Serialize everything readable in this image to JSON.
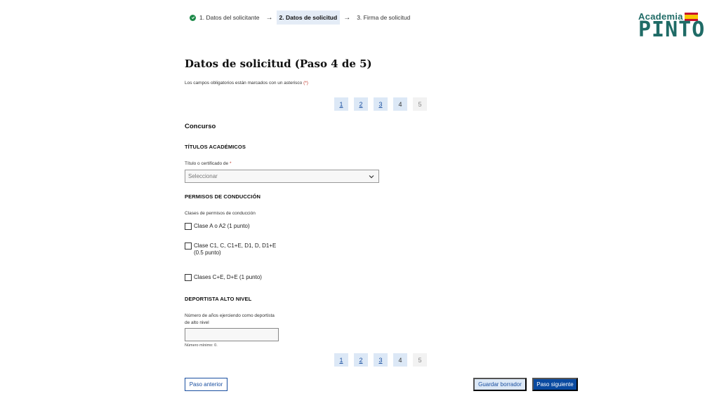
{
  "stepper": {
    "steps": [
      {
        "label": "1. Datos del solicitante",
        "state": "done"
      },
      {
        "label": "2. Datos de solicitud",
        "state": "active"
      },
      {
        "label": "3. Firma de solicitud",
        "state": "pending"
      }
    ],
    "separator": "→"
  },
  "logo": {
    "top": "Academia",
    "main": "PINTO"
  },
  "page_title": "Datos de solicitud (Paso 4 de 5)",
  "required_note": "Los campos obligatorios están marcados con un asterisco",
  "required_mark": "(*)",
  "pagination": [
    "1",
    "2",
    "3",
    "4",
    "5"
  ],
  "section_title": "Concurso",
  "academic": {
    "heading": "TÍTULOS ACADÉMICOS",
    "field_label": "Título o certificado de",
    "required": "*",
    "select_value": "Seleccionar"
  },
  "driving": {
    "heading": "PERMISOS DE CONDUCCIÓN",
    "field_label": "Clases de permisos de conducción",
    "options": [
      {
        "line1": "Clase A o A2 (1 punto)",
        "line2": ""
      },
      {
        "line1": "Clase C1, C, C1+E, D1, D, D1+E",
        "line2": "(0.5 punto)"
      },
      {
        "line1": "Clases C+E, D+E (1 punto)",
        "line2": ""
      }
    ]
  },
  "athlete": {
    "heading": "DEPORTISTA ALTO NIVEL",
    "field_label_1": "Número de años ejerciendo como deportista",
    "field_label_2": "de alto nivel",
    "input_value": "",
    "hint": "Número mínimo: 0."
  },
  "actions": {
    "prev": "Paso anterior",
    "draft": "Guardar borrador",
    "next": "Paso siguiente"
  },
  "colors": {
    "primary": "#0a4aa0",
    "success": "#1e8a4a",
    "logo": "#1f6b66",
    "required": "#c0392b"
  }
}
